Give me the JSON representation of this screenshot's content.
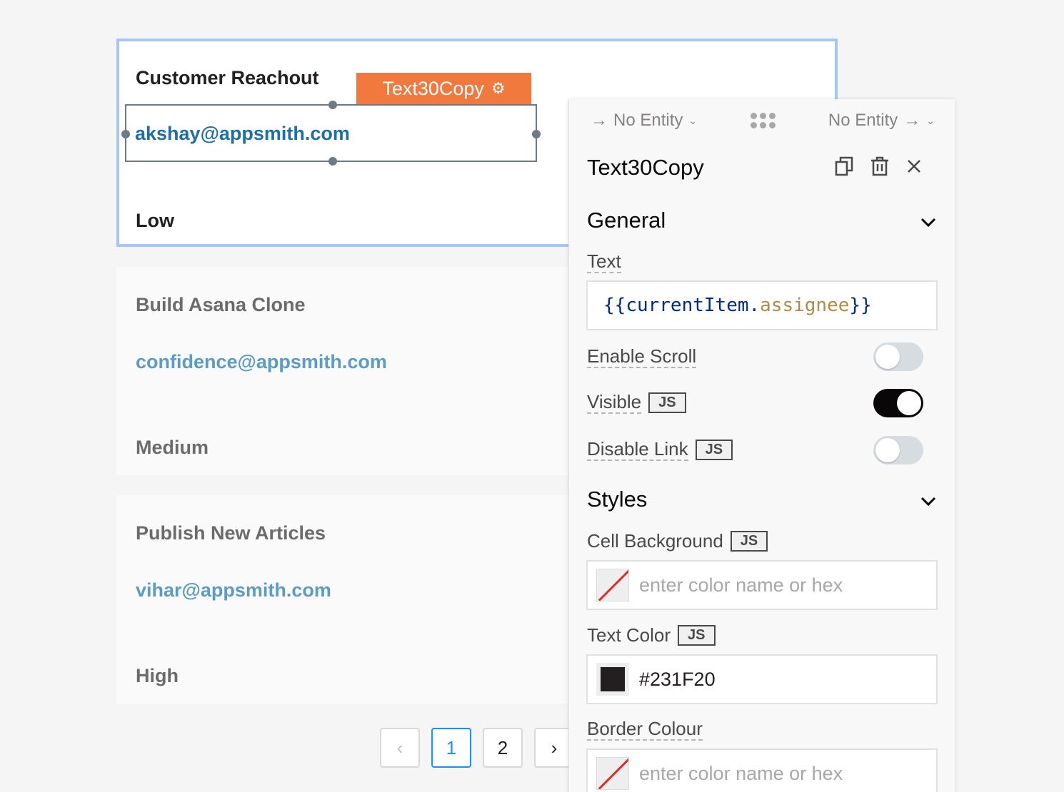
{
  "list": {
    "items": [
      {
        "title": "Customer Reachout",
        "email": "akshay@appsmith.com",
        "priority": "Low"
      },
      {
        "title": "Build Asana Clone",
        "email": "confidence@appsmith.com",
        "priority": "Medium"
      },
      {
        "title": "Publish New Articles",
        "email": "vihar@appsmith.com",
        "priority": "High"
      }
    ]
  },
  "widget_tag": {
    "label": "Text30Copy"
  },
  "pagination": {
    "prev": "‹",
    "pages": [
      "1",
      "2"
    ],
    "next": "›",
    "current": "1"
  },
  "property_pane": {
    "nav": {
      "left_label": "No Entity",
      "right_label": "No Entity"
    },
    "title": "Text30Copy",
    "sections": {
      "general": {
        "label": "General",
        "text_label": "Text",
        "text_value": {
          "open": "{{",
          "object": "currentItem",
          "dot": ".",
          "property": "assignee",
          "close": "}}"
        },
        "enable_scroll_label": "Enable Scroll",
        "enable_scroll": false,
        "visible_label": "Visible",
        "visible": true,
        "disable_link_label": "Disable Link",
        "disable_link": false,
        "js_badge": "JS"
      },
      "styles": {
        "label": "Styles",
        "cell_background_label": "Cell Background",
        "cell_background_placeholder": "enter color name or hex",
        "text_color_label": "Text Color",
        "text_color_value": "#231F20",
        "border_colour_label": "Border Colour",
        "border_colour_placeholder": "enter color name or hex"
      }
    }
  },
  "colors": {
    "selection_outline": "#a6c6f5",
    "tag_bg": "#f2793e",
    "link": "#1d6fa5",
    "text_color_swatch": "#231F20"
  }
}
